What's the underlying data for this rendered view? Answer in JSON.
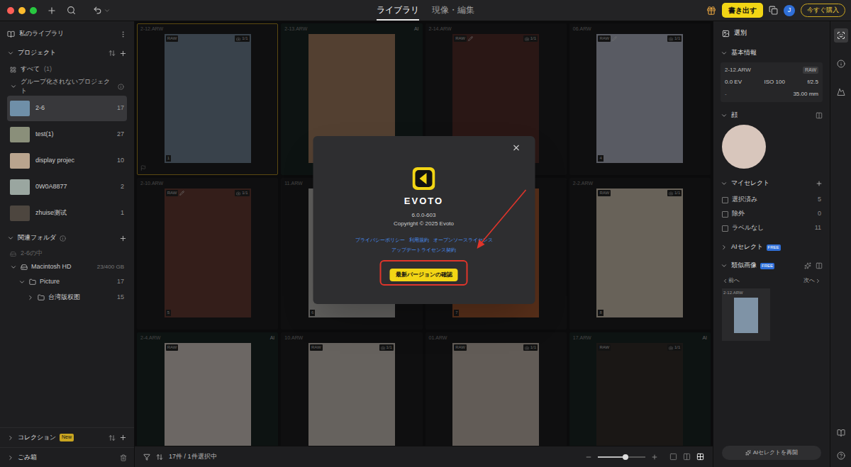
{
  "toolbar": {
    "tabs": [
      {
        "label": "ライブラリ",
        "selected": true
      },
      {
        "label": "現像・編集",
        "selected": false
      }
    ],
    "export_button": "書き出す",
    "avatar": "J",
    "buy_button": "今すぐ購入"
  },
  "sidebar": {
    "library_title": "私のライブラリ",
    "projects_header": {
      "label": "プロジェクト",
      "expanded": true
    },
    "all": {
      "label": "すべて",
      "count": "(1)"
    },
    "group_header": {
      "label": "グループ化されないプロジェクト",
      "expanded": true
    },
    "projects": [
      {
        "name": "2-6",
        "count": "17",
        "selected": true,
        "color": "#6f8fa8"
      },
      {
        "name": "test(1)",
        "count": "27",
        "selected": false,
        "color": "#8a8f7a"
      },
      {
        "name": "display projec",
        "count": "10",
        "selected": false,
        "color": "#b9a48e"
      },
      {
        "name": "0W0A8877",
        "count": "2",
        "selected": false,
        "color": "#9aa6a0"
      },
      {
        "name": "zhuise测试",
        "count": "1",
        "selected": false,
        "color": "#4d463f"
      }
    ],
    "folders_header": {
      "label": "関連フォルダ",
      "expanded": true
    },
    "folder_scope": "2-6の中",
    "drive": {
      "name": "Macintosh HD",
      "usage": "23/400 GB",
      "expanded": true
    },
    "folders": [
      {
        "name": "Picture",
        "count": "17",
        "depth": 1,
        "expanded": true
      },
      {
        "name": "台湾版权图",
        "count": "15",
        "depth": 2,
        "expanded": false
      }
    ],
    "collections": {
      "label": "コレクション",
      "badge": "New",
      "expanded": false
    },
    "trash": {
      "label": "ごみ箱",
      "expanded": false
    }
  },
  "grid": {
    "cells": [
      {
        "name": "2-12.ARW",
        "raw": "RAW",
        "edited": false,
        "ai": "",
        "count": "1/1",
        "index": "1",
        "selected": true,
        "flagged": true,
        "color": "#7f93a6"
      },
      {
        "name": "2-13.ARW",
        "raw": "",
        "edited": false,
        "ai": "AI",
        "count": "",
        "index": "",
        "selected": false,
        "flagged": false,
        "color": "#b88f6e"
      },
      {
        "name": "2-14.ARW",
        "raw": "RAW",
        "edited": true,
        "ai": "",
        "count": "1/1",
        "index": "",
        "selected": false,
        "flagged": false,
        "color": "#5e3430"
      },
      {
        "name": "06.ARW",
        "raw": "RAW",
        "edited": true,
        "ai": "",
        "count": "1/1",
        "index": "4",
        "selected": false,
        "flagged": false,
        "color": "#c5cadb"
      },
      {
        "name": "2-10.ARW",
        "raw": "RAW",
        "edited": true,
        "ai": "",
        "count": "1/1",
        "index": "5",
        "selected": false,
        "flagged": false,
        "color": "#74443a"
      },
      {
        "name": "11.ARW",
        "raw": "",
        "edited": false,
        "ai": "",
        "count": "",
        "index": "6",
        "selected": false,
        "flagged": false,
        "color": "#d6d2ce"
      },
      {
        "name": "",
        "raw": "",
        "edited": false,
        "ai": "",
        "count": "",
        "index": "7",
        "selected": false,
        "flagged": false,
        "color": "#c0683a"
      },
      {
        "name": "2-2.ARW",
        "raw": "RAW",
        "edited": false,
        "ai": "",
        "count": "1/1",
        "index": "8",
        "selected": false,
        "flagged": false,
        "color": "#e6d9c6"
      },
      {
        "name": "2-4.ARW",
        "raw": "RAW",
        "edited": false,
        "ai": "AI",
        "count": "",
        "index": "",
        "selected": false,
        "flagged": false,
        "color": "#efe4de"
      },
      {
        "name": "10.ARW",
        "raw": "RAW",
        "edited": false,
        "ai": "",
        "count": "1/1",
        "index": "",
        "selected": false,
        "flagged": false,
        "color": "#e3d9d1"
      },
      {
        "name": "01.ARW",
        "raw": "RAW",
        "edited": false,
        "ai": "",
        "count": "1/1",
        "index": "",
        "selected": false,
        "flagged": false,
        "color": "#dacdc2"
      },
      {
        "name": "17.ARW",
        "raw": "RAW",
        "edited": false,
        "ai": "AI",
        "count": "1/1",
        "index": "",
        "selected": false,
        "flagged": false,
        "color": "#3a332f"
      }
    ]
  },
  "status_bar": {
    "summary": "17件 / 1件選択中",
    "zoom_level": 0.58,
    "views": [
      {
        "kind": "single",
        "selected": false
      },
      {
        "kind": "compare",
        "selected": false
      },
      {
        "kind": "grid",
        "selected": true
      }
    ]
  },
  "dialog": {
    "wordmark": "EVOTO",
    "version": "6.0.0-603",
    "copyright": "Copyright © 2025 Evoto",
    "links": [
      "プライバシーポリシー",
      "利用規約",
      "オープンソースライセンス"
    ],
    "links2": [
      "アップデートライセンス契約"
    ],
    "check_button": "最新バージョンの確認",
    "highlighted": true
  },
  "right_panel": {
    "culling_title": "選別",
    "basic_info": {
      "title": "基本情報",
      "expanded": true,
      "file": "2-12.ARW",
      "format": "RAW",
      "exposure": "0.0 EV",
      "iso": "ISO 100",
      "aperture": "f/2.5",
      "lens": "-",
      "focal": "35.00 mm"
    },
    "faces": {
      "title": "顔",
      "expanded": true,
      "color": "#d8c6bc"
    },
    "my_select": {
      "title": "マイセレクト",
      "expanded": true,
      "options": [
        {
          "label": "選択済み",
          "count": "5",
          "checked": false
        },
        {
          "label": "除外",
          "count": "0",
          "checked": false
        },
        {
          "label": "ラベルなし",
          "count": "11",
          "checked": false
        }
      ]
    },
    "ai_select": {
      "title": "AIセレクト",
      "badge": "FREE",
      "expanded": false
    },
    "similar": {
      "title": "類似画像",
      "badge": "FREE",
      "expanded": true,
      "prev": "前へ",
      "next": "次へ",
      "thumbs": [
        {
          "name": "2-12.ARW",
          "color": "#7f93a6"
        }
      ]
    },
    "resume_button": "AIセレクトを再開"
  },
  "strip": [
    {
      "selected": true
    },
    {
      "selected": false
    },
    {
      "selected": false
    }
  ]
}
